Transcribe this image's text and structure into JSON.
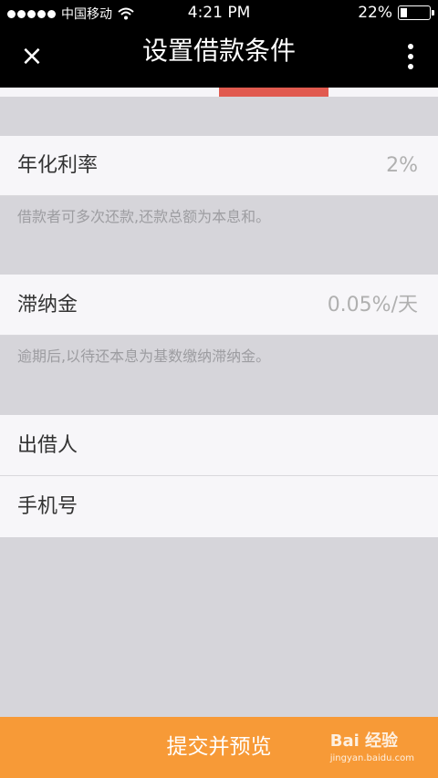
{
  "status_bar": {
    "carrier": "中国移动",
    "time": "4:21 PM",
    "battery": "22%",
    "battery_level": 0.22
  },
  "nav": {
    "close_icon": "×",
    "title": "设置借款条件",
    "more_icon": "vertical-ellipsis"
  },
  "step_progress": {
    "active_step": 3,
    "total_steps": 4
  },
  "fields": {
    "interest": {
      "label": "年化利率",
      "value": "2%",
      "note": "借款者可多次还款,还款总额为本息和。"
    },
    "late_fee": {
      "label": "滞纳金",
      "value": "0.05%/天",
      "note": "逾期后,以待还本息为基数缴纳滞纳金。"
    },
    "lender": {
      "label": "出借人"
    },
    "phone": {
      "label": "手机号"
    }
  },
  "submit": {
    "label": "提交并预览"
  },
  "watermark": {
    "main": "Bai 经验",
    "sub": "jingyan.baidu.com"
  },
  "colors": {
    "accent": "#f79a37",
    "progress": "#e15a4f",
    "background": "#d6d5da"
  }
}
